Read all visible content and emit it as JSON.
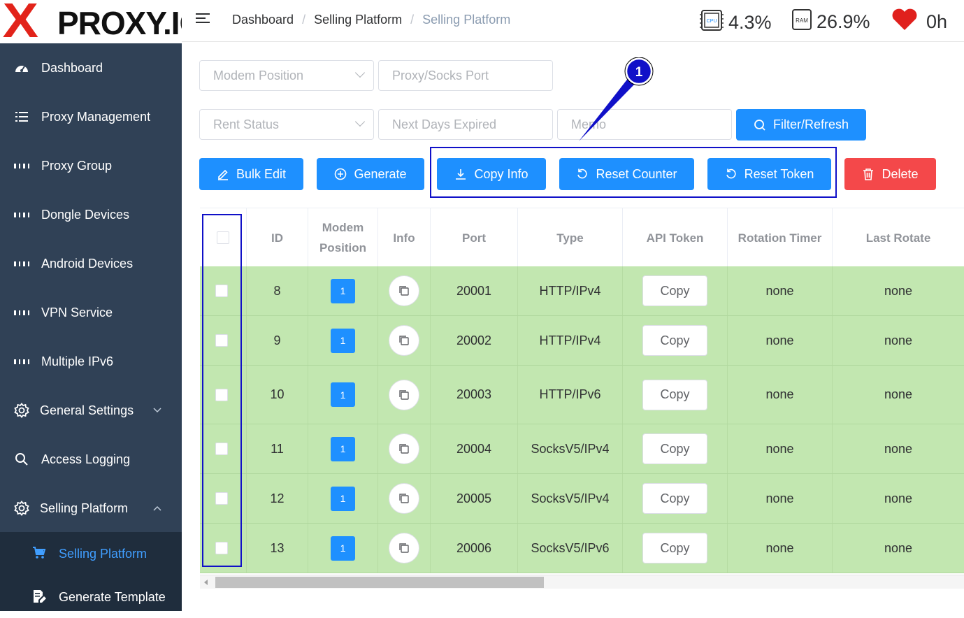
{
  "logo": {
    "x": "X",
    "text": "PROXY.IO"
  },
  "sidebar": {
    "items": [
      {
        "label": "Dashboard",
        "icon": "dashboard-icon"
      },
      {
        "label": "Proxy Management",
        "icon": "list-icon"
      },
      {
        "label": "Proxy Group",
        "icon": "grid-icon"
      },
      {
        "label": "Dongle Devices",
        "icon": "grid-icon"
      },
      {
        "label": "Android Devices",
        "icon": "grid-icon"
      },
      {
        "label": "VPN Service",
        "icon": "grid-icon"
      },
      {
        "label": "Multiple IPv6",
        "icon": "grid-icon"
      },
      {
        "label": "General Settings",
        "icon": "gear-icon"
      },
      {
        "label": "Access Logging",
        "icon": "search-icon"
      },
      {
        "label": "Selling Platform",
        "icon": "gear-icon"
      }
    ],
    "sub_items": [
      {
        "label": "Selling Platform",
        "icon": "cart-icon"
      },
      {
        "label": "Generate Template",
        "icon": "document-edit-icon"
      }
    ]
  },
  "header": {
    "breadcrumb": [
      "Dashboard",
      "Selling Platform",
      "Selling Platform"
    ],
    "cpu": "4.3%",
    "ram": "26.9%",
    "uptime": "0h",
    "cpu_chip": "CPU",
    "ram_chip": "RAM"
  },
  "filters": {
    "modem_position": "Modem Position",
    "proxy_port": "Proxy/Socks Port",
    "rent_status": "Rent Status",
    "next_days": "Next Days Expired",
    "memo": "Memo",
    "filter_btn": "Filter/Refresh"
  },
  "actions": {
    "bulk_edit": "Bulk Edit",
    "generate": "Generate",
    "copy_info": "Copy Info",
    "reset_counter": "Reset Counter",
    "reset_token": "Reset Token",
    "delete": "Delete"
  },
  "annotation": {
    "number": "1"
  },
  "table": {
    "headers": [
      "ID",
      "Modem Position",
      "Info",
      "Port",
      "Type",
      "API Token",
      "Rotation Timer",
      "Last Rotate"
    ],
    "rows": [
      {
        "id": "8",
        "pos": "1",
        "port": "20001",
        "type": "HTTP/IPv4",
        "token": "Copy",
        "timer": "none",
        "last": "none"
      },
      {
        "id": "9",
        "pos": "1",
        "port": "20002",
        "type": "HTTP/IPv4",
        "token": "Copy",
        "timer": "none",
        "last": "none"
      },
      {
        "id": "10",
        "pos": "1",
        "port": "20003",
        "type": "HTTP/IPv6",
        "token": "Copy",
        "timer": "none",
        "last": "none"
      },
      {
        "id": "11",
        "pos": "1",
        "port": "20004",
        "type": "SocksV5/IPv4",
        "token": "Copy",
        "timer": "none",
        "last": "none"
      },
      {
        "id": "12",
        "pos": "1",
        "port": "20005",
        "type": "SocksV5/IPv4",
        "token": "Copy",
        "timer": "none",
        "last": "none"
      },
      {
        "id": "13",
        "pos": "1",
        "port": "20006",
        "type": "SocksV5/IPv6",
        "token": "Copy",
        "timer": "none",
        "last": "none"
      }
    ]
  },
  "colors": {
    "sidebar": "#304156",
    "primary": "#1e90ff",
    "danger": "#f4484a",
    "row": "#c2e7b0",
    "annotation": "#1010c8"
  }
}
